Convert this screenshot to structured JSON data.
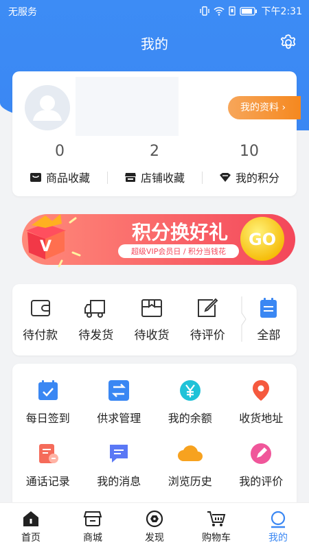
{
  "status_bar": {
    "carrier": "无服务",
    "time": "下午2:31"
  },
  "header": {
    "title": "我的"
  },
  "profile": {
    "my_info_button": "我的资料 ›",
    "stats": [
      {
        "value": "0",
        "label": "商品收藏",
        "icon": "bag-icon"
      },
      {
        "value": "2",
        "label": "店铺收藏",
        "icon": "shop-icon"
      },
      {
        "value": "10",
        "label": "我的积分",
        "icon": "diamond-icon"
      }
    ]
  },
  "banner": {
    "title": "积分换好礼",
    "subtitle": "超级VIP会员日 / 积分当钱花",
    "go": "GO",
    "badge": "V"
  },
  "orders": [
    {
      "label": "待付款",
      "icon": "wallet-icon"
    },
    {
      "label": "待发货",
      "icon": "truck-icon"
    },
    {
      "label": "待收货",
      "icon": "package-icon"
    },
    {
      "label": "待评价",
      "icon": "edit-icon"
    },
    {
      "label": "全部",
      "icon": "calendar-list-icon"
    }
  ],
  "tools": [
    {
      "label": "每日签到",
      "icon": "calendar-check-icon"
    },
    {
      "label": "供求管理",
      "icon": "exchange-icon"
    },
    {
      "label": "我的余额",
      "icon": "yen-icon"
    },
    {
      "label": "收货地址",
      "icon": "location-icon"
    },
    {
      "label": "通话记录",
      "icon": "call-log-icon"
    },
    {
      "label": "我的消息",
      "icon": "message-icon"
    },
    {
      "label": "浏览历史",
      "icon": "cloud-icon"
    },
    {
      "label": "我的评价",
      "icon": "pen-icon"
    }
  ],
  "tabs": [
    {
      "label": "首页",
      "icon": "home-icon"
    },
    {
      "label": "商城",
      "icon": "store-icon"
    },
    {
      "label": "发现",
      "icon": "compass-icon"
    },
    {
      "label": "购物车",
      "icon": "cart-icon"
    },
    {
      "label": "我的",
      "icon": "user-icon",
      "active": true
    }
  ],
  "colors": {
    "primary": "#3a87f3",
    "orange": "#f5881f",
    "banner_red": "#f45a5a"
  }
}
